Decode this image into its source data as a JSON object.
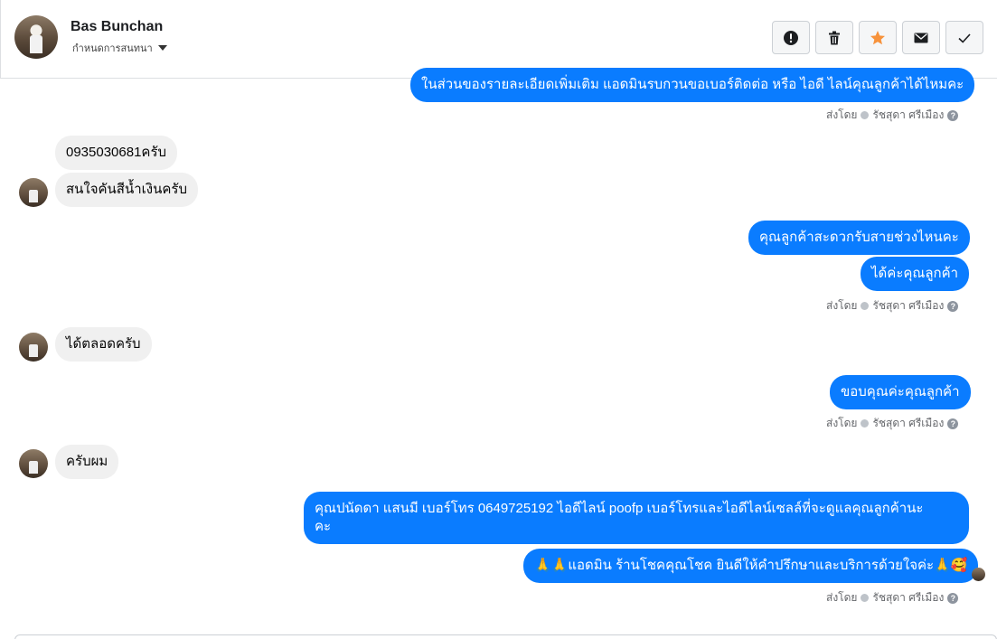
{
  "header": {
    "name": "Bas Bunchan",
    "subtitle": "กำหนดการสนทนา"
  },
  "actions": [
    {
      "icon": "alert-icon"
    },
    {
      "icon": "trash-icon"
    },
    {
      "icon": "star-icon",
      "color": "#f7923b"
    },
    {
      "icon": "mail-icon"
    },
    {
      "icon": "check-icon"
    }
  ],
  "messages": {
    "m0": "ในส่วนของรายละเอียดเพิ่มเติม แอดมินรบกวนขอเบอร์ติดต่อ หรือ ไอดี ไลน์คุณลูกค้าได้ไหมคะ",
    "m1": "0935030681ครับ",
    "m2": "สนใจคันสีน้ำเงินครับ",
    "m3": "คุณลูกค้าสะดวกรับสายช่วงไหนคะ",
    "m4": "ได้ค่ะคุณลูกค้า",
    "m5": "ได้ตลอดครับ",
    "m6": "ขอบคุณค่ะคุณลูกค้า",
    "m7": "ครับผม",
    "m8_line1": "คุณปนัดดา แสนมี   เบอร์โทร 0649725192  ไอดีไลน์ poofp  เบอร์โทรและไอดีไลน์เซลล์ที่จะดูแลคุณลูกค้านะ",
    "m8_line2": "คะ",
    "m9": "🙏🙏แอดมิน ร้านโชคคุณโชค ยินดีให้คำปรึกษาและบริการด้วยใจค่ะ🙏🥰"
  },
  "sent_by": {
    "prefix": "ส่งโดย",
    "name": "รัชสุดา ศรีเมือง",
    "help": "?"
  },
  "colors": {
    "outgoing": "#0a7cff",
    "incoming": "#f0f0f0",
    "star": "#f7923b"
  }
}
